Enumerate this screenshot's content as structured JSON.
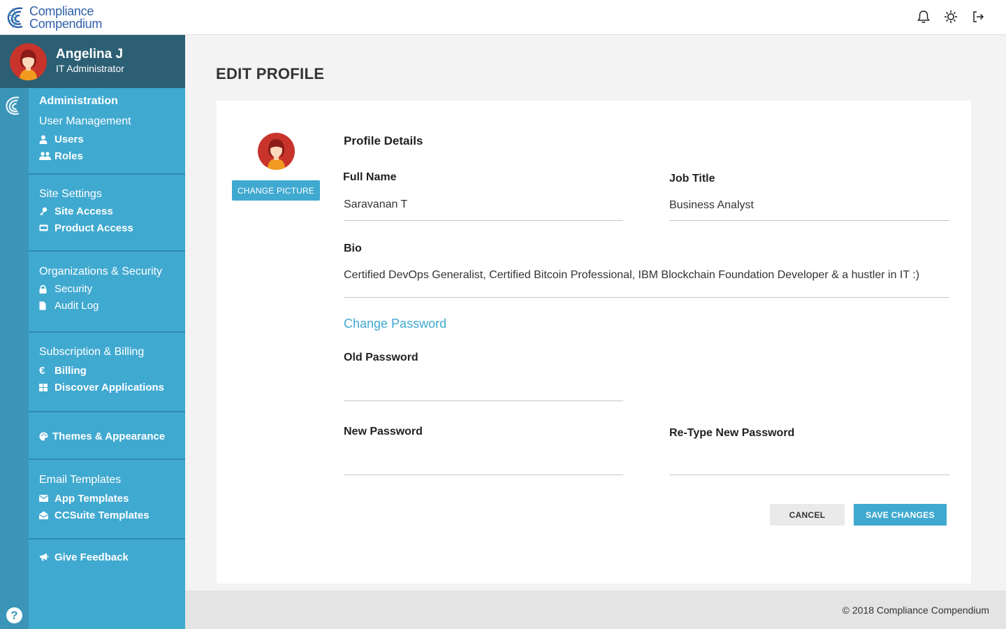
{
  "brand": {
    "line1": "Compliance",
    "line2": "Compendium"
  },
  "topbar": {
    "icons": [
      "bell-icon",
      "sun-icon",
      "logout-icon"
    ]
  },
  "user": {
    "name": "Angelina J",
    "role": "IT Administrator"
  },
  "sidebar": {
    "sections": [
      {
        "title": "Administration",
        "subtitle": "User Management",
        "items": [
          {
            "label": "Users",
            "icon": "user-icon"
          },
          {
            "label": "Roles",
            "icon": "users-icon"
          }
        ]
      },
      {
        "title": "Site Settings",
        "items": [
          {
            "label": "Site Access",
            "icon": "key-icon"
          },
          {
            "label": "Product Access",
            "icon": "card-icon"
          }
        ]
      },
      {
        "title": "Organizations & Security",
        "items": [
          {
            "label": "Security",
            "icon": "lock-icon"
          },
          {
            "label": "Audit Log",
            "icon": "file-icon"
          }
        ]
      },
      {
        "title": "Subscription & Billing",
        "items": [
          {
            "label": "Billing",
            "icon": "euro-icon"
          },
          {
            "label": "Discover Applications",
            "icon": "grid-icon"
          }
        ]
      },
      {
        "items": [
          {
            "label": "Themes & Appearance",
            "icon": "palette-icon"
          }
        ]
      },
      {
        "title": "Email Templates",
        "items": [
          {
            "label": "App Templates",
            "icon": "envelope-icon"
          },
          {
            "label": "CCSuite Templates",
            "icon": "envelope-open-icon"
          }
        ]
      },
      {
        "items": [
          {
            "label": "Give Feedback",
            "icon": "megaphone-icon"
          }
        ]
      }
    ],
    "help": "?"
  },
  "page": {
    "title": "EDIT PROFILE",
    "change_picture": "CHANGE PICTURE",
    "profile_details": "Profile Details",
    "full_name": {
      "label": "Full Name",
      "value": "Saravanan T"
    },
    "job_title": {
      "label": "Job Title",
      "value": "Business Analyst"
    },
    "bio": {
      "label": "Bio",
      "value": "Certified DevOps Generalist, Certified Bitcoin Professional, IBM Blockchain Foundation Developer & a hustler in IT :)"
    },
    "change_password": "Change Password",
    "old_password": {
      "label": "Old Password",
      "value": ""
    },
    "new_password": {
      "label": "New Password",
      "value": ""
    },
    "retype_password": {
      "label": "Re-Type New Password",
      "value": ""
    },
    "cancel": "CANCEL",
    "save": "SAVE CHANGES"
  },
  "footer": {
    "copyright": "© 2018 Compliance Compendium"
  },
  "colors": {
    "accent": "#40a9d0",
    "accent_dark": "#2c5f74",
    "rail": "#3a95b8",
    "brand": "#2f5fa8"
  }
}
